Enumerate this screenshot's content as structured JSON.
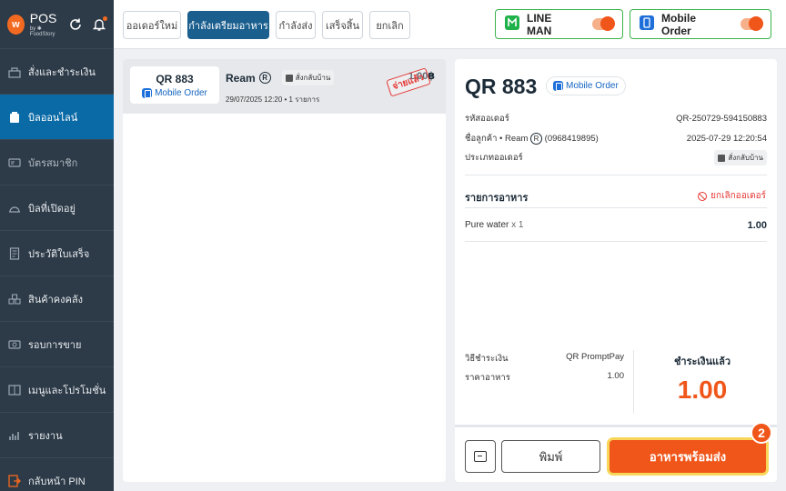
{
  "brand": {
    "logo_letter": "w",
    "name": "POS",
    "sub": "by ✱ FoodStory",
    "accent": "#f26a21",
    "refresh_icon": "refresh-icon",
    "bell_icon": "bell-icon"
  },
  "sidebar": {
    "items": [
      {
        "label": "สั่งและชำระเงิน",
        "icon": "order-icon"
      },
      {
        "label": "บิลออนไลน์",
        "icon": "online-bill-icon"
      },
      {
        "label": "บัตรสมาชิก",
        "icon": "member-card-icon"
      },
      {
        "label": "บิลที่เปิดอยู่",
        "icon": "open-bill-icon"
      },
      {
        "label": "ประวัติใบเสร็จ",
        "icon": "receipt-icon"
      },
      {
        "label": "สินค้าคงคลัง",
        "icon": "inventory-icon"
      },
      {
        "label": "รอบการขาย",
        "icon": "sales-round-icon"
      },
      {
        "label": "เมนูและโปรโมชั่น",
        "icon": "menu-icon"
      },
      {
        "label": "รายงาน",
        "icon": "report-icon"
      },
      {
        "label": "กลับหน้า PIN",
        "icon": "logout-icon"
      }
    ],
    "active_index": 1,
    "active_color": "#0a6aa6"
  },
  "tabs": [
    {
      "label": "ออเดอร์ใหม่"
    },
    {
      "label": "กำลังเตรียมอาหาร"
    },
    {
      "label": "กำลังส่ง"
    },
    {
      "label": "เสร็จสิ้น"
    },
    {
      "label": "ยกเลิก"
    }
  ],
  "channels": {
    "lineman": {
      "label": "LINE MAN",
      "enabled": true
    },
    "mobile_order": {
      "label": "Mobile Order",
      "enabled": true
    }
  },
  "order_list": [
    {
      "qr": "QR 883",
      "source": "Mobile Order",
      "customer": "Ream",
      "customer_mark": "R",
      "type": "สั่งกลับบ้าน",
      "meta": "29/07/2025 12:20 • 1 รายการ",
      "amount": "1.00฿",
      "stamp": "จ่ายแล้ว"
    }
  ],
  "detail": {
    "title": "QR 883",
    "source": "Mobile Order",
    "order_id_label": "รหัสออเดอร์",
    "order_id": "QR-250729-594150883",
    "customer_label": "ชื่อลูกค้า • Ream",
    "customer_mark": "R",
    "customer_phone": "(0968419895)",
    "datetime": "2025-07-29 12:20:54",
    "order_type_label": "ประเภทออเดอร์",
    "order_type": "สั่งกลับบ้าน",
    "items_title": "รายการอาหาร",
    "cancel_label": "ยกเลิกออเดอร์",
    "items": [
      {
        "name": "Pure water",
        "qty": "x 1",
        "price": "1.00"
      }
    ],
    "payment_method_label": "วิธีชำระเงิน",
    "payment_method": "QR PromptPay",
    "food_price_label": "ราคาอาหาร",
    "food_price": "1.00",
    "paid_label": "ชำระเงินแล้ว",
    "paid_amount": "1.00",
    "print_label": "พิมพ์",
    "ready_label": "อาหารพร้อมส่ง",
    "step_badge": "2",
    "accent": "#f0561a"
  }
}
